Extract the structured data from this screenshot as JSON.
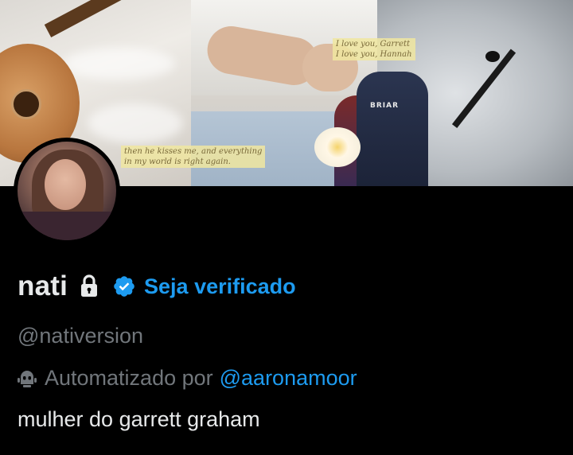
{
  "banner": {
    "caption_1_line1": "then he kisses me, and everything",
    "caption_1_line2": "in my world is right again.",
    "caption_2_line1": "I love you, Garrett",
    "caption_2_line2": "I love you, Hannah",
    "jersey_text": "BRIAR"
  },
  "profile": {
    "name": "nati",
    "lock_icon": "lock-icon",
    "verified_icon": "verified-badge-icon",
    "verify_link": "Seja verificado",
    "handle": "@nativersion",
    "automated_label": "Automatizado por",
    "automated_by": "@aaronamoor",
    "bio": "mulher do garrett graham"
  },
  "colors": {
    "background": "#000000",
    "primary_text": "#e7e9ea",
    "secondary_text": "#71767b",
    "accent": "#1d9bf0"
  }
}
